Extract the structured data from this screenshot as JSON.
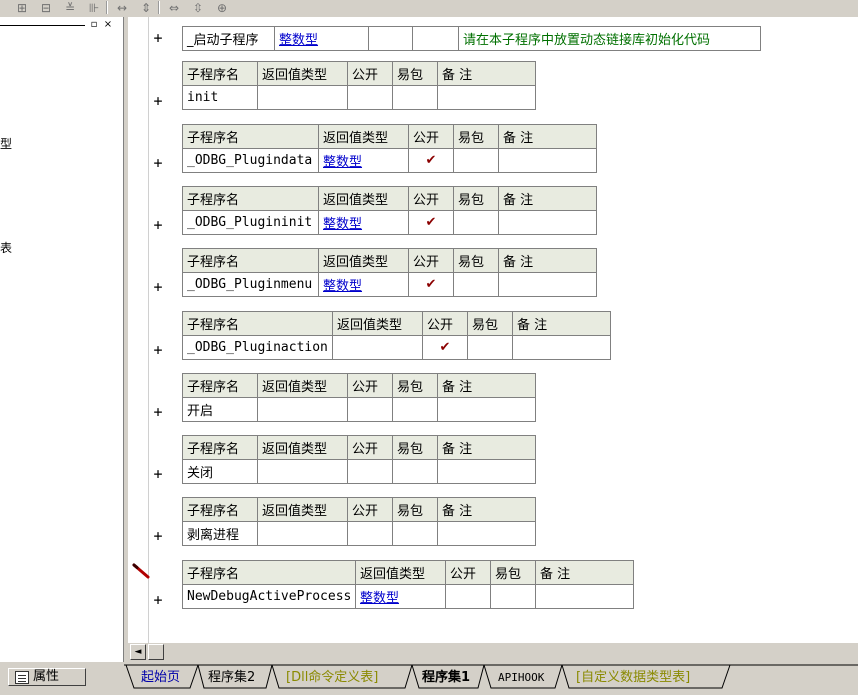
{
  "toolbar": {
    "icons": [
      "grid-icon",
      "form-icon",
      "menu-icon",
      "align-icon",
      "hspace-icon",
      "vspace-icon",
      "hsize-icon",
      "vsize-icon",
      "center-icon"
    ]
  },
  "left_pane": {
    "frag_1": "型",
    "frag_2": "表",
    "min_glyph": "▫",
    "close_glyph": "×"
  },
  "startup_row": {
    "plus": "+",
    "name": "_启动子程序",
    "type": "整数型",
    "note": "请在本子程序中放置动态链接库初始化代码"
  },
  "headers": {
    "name": "子程序名",
    "return_type": "返回值类型",
    "public": "公开",
    "easy_pack": "易包",
    "note": "备 注"
  },
  "subroutines": [
    {
      "name": "init",
      "type": "",
      "public": ""
    },
    {
      "name": "_ODBG_Plugindata",
      "type": "整数型",
      "public": "✔"
    },
    {
      "name": "_ODBG_Plugininit",
      "type": "整数型",
      "public": "✔"
    },
    {
      "name": "_ODBG_Pluginmenu",
      "type": "整数型",
      "public": "✔"
    },
    {
      "name": "_ODBG_Pluginaction",
      "type": "",
      "public": "✔"
    },
    {
      "name": "开启",
      "type": "",
      "public": ""
    },
    {
      "name": "关闭",
      "type": "",
      "public": ""
    },
    {
      "name": "剥离进程",
      "type": "",
      "public": ""
    },
    {
      "name": "NewDebugActiveProcess",
      "type": "整数型",
      "public": ""
    }
  ],
  "plus": "+",
  "bottom": {
    "props_label": "属性",
    "scroll_left": "◄",
    "tabs": [
      "起始页",
      "程序集2",
      "[Dll命令定义表]",
      "程序集1",
      "APIHOOK",
      "[自定义数据类型表]"
    ]
  }
}
